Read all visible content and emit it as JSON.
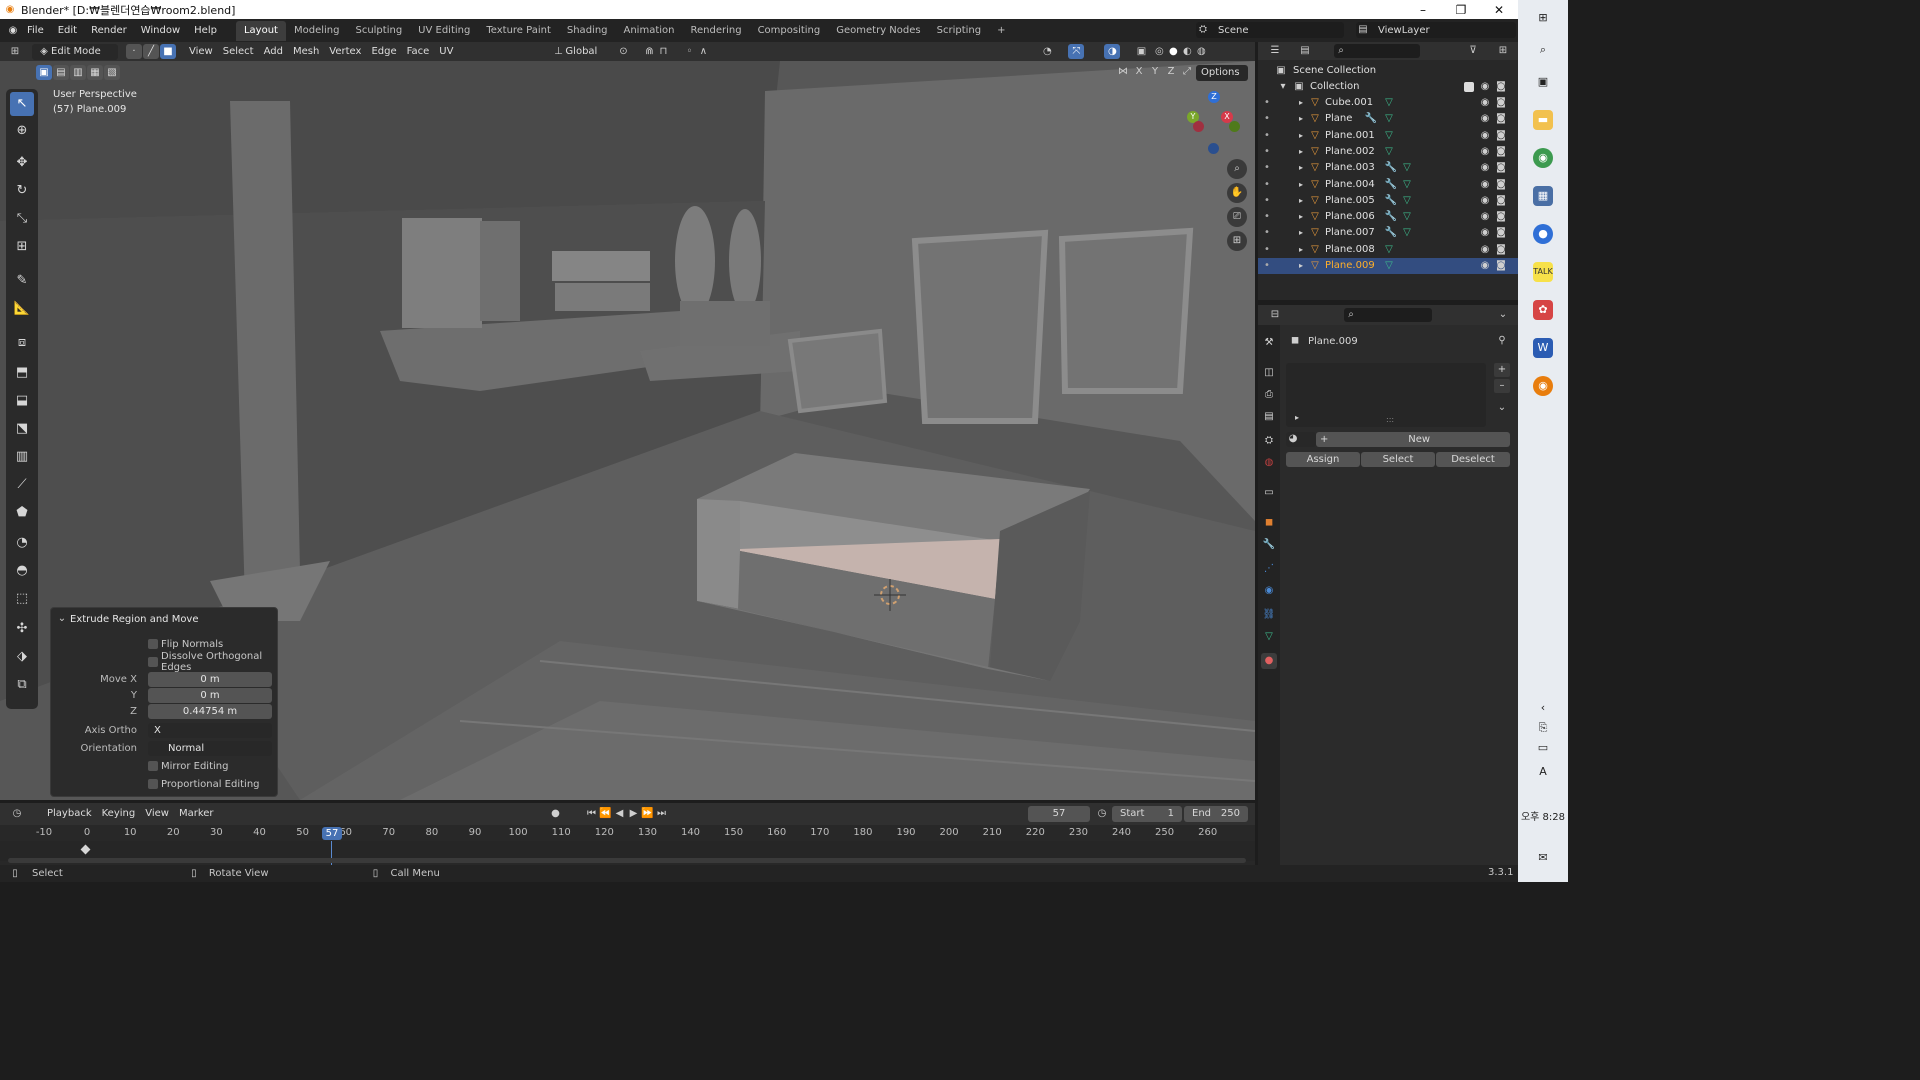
{
  "window": {
    "title": "Blender* [D:₩블렌더연습₩room2.blend]",
    "controls": [
      "–",
      "❐",
      "✕"
    ]
  },
  "menubar": {
    "items": [
      "File",
      "Edit",
      "Render",
      "Window",
      "Help"
    ],
    "workspaces": [
      "Layout",
      "Modeling",
      "Sculpting",
      "UV Editing",
      "Texture Paint",
      "Shading",
      "Animation",
      "Rendering",
      "Compositing",
      "Geometry Nodes",
      "Scripting"
    ],
    "active_workspace": "Layout",
    "add_workspace": "+",
    "scene": "Scene",
    "view_layer": "ViewLayer"
  },
  "viewport_header": {
    "mode": "Edit Mode",
    "menus": [
      "View",
      "Select",
      "Add",
      "Mesh",
      "Vertex",
      "Edge",
      "Face",
      "UV"
    ],
    "transform_orientation": "Global",
    "options": "Options",
    "axes": [
      "X",
      "Y",
      "Z"
    ]
  },
  "viewport": {
    "perspective_label": "User Perspective",
    "object_label": "(57) Plane.009",
    "gizmo": {
      "z": "Z",
      "y": "Y",
      "x": "X"
    }
  },
  "operator_panel": {
    "title": "Extrude Region and Move",
    "flip_normals": "Flip Normals",
    "dissolve": "Dissolve Orthogonal Edges",
    "move_x_label": "Move X",
    "move_x": "0 m",
    "y_label": "Y",
    "move_y": "0 m",
    "z_label": "Z",
    "move_z": "0.44754 m",
    "axis_ortho_label": "Axis Ortho",
    "axis_ortho": "X",
    "orientation_label": "Orientation",
    "orientation": "Normal",
    "mirror": "Mirror Editing",
    "proportional": "Proportional Editing"
  },
  "timeline": {
    "menus": [
      "Playback",
      "Keying",
      "View",
      "Marker"
    ],
    "current_frame": "57",
    "start_label": "Start",
    "start": "1",
    "end_label": "End",
    "end": "250",
    "ticks": [
      "-10",
      "0",
      "10",
      "20",
      "30",
      "40",
      "50",
      "60",
      "70",
      "80",
      "90",
      "100",
      "110",
      "120",
      "130",
      "140",
      "150",
      "160",
      "170",
      "180",
      "190",
      "200",
      "210",
      "220",
      "230",
      "240",
      "250",
      "260"
    ],
    "playhead": "57"
  },
  "statusbar": {
    "select": "Select",
    "rotate": "Rotate View",
    "call_menu": "Call Menu",
    "version": "3.3.1"
  },
  "outliner": {
    "scene_collection": "Scene Collection",
    "collection": "Collection",
    "objects": [
      "Cube.001",
      "Plane",
      "Plane.001",
      "Plane.002",
      "Plane.003",
      "Plane.004",
      "Plane.005",
      "Plane.006",
      "Plane.007",
      "Plane.008",
      "Plane.009"
    ],
    "selected": "Plane.009"
  },
  "properties": {
    "object_name": "Plane.009",
    "new_button": "New",
    "assign": "Assign",
    "select": "Select",
    "deselect": "Deselect",
    "list_add": "+",
    "list_remove": "–"
  },
  "taskbar": {
    "time": "오후 8:28",
    "ime": "A"
  }
}
